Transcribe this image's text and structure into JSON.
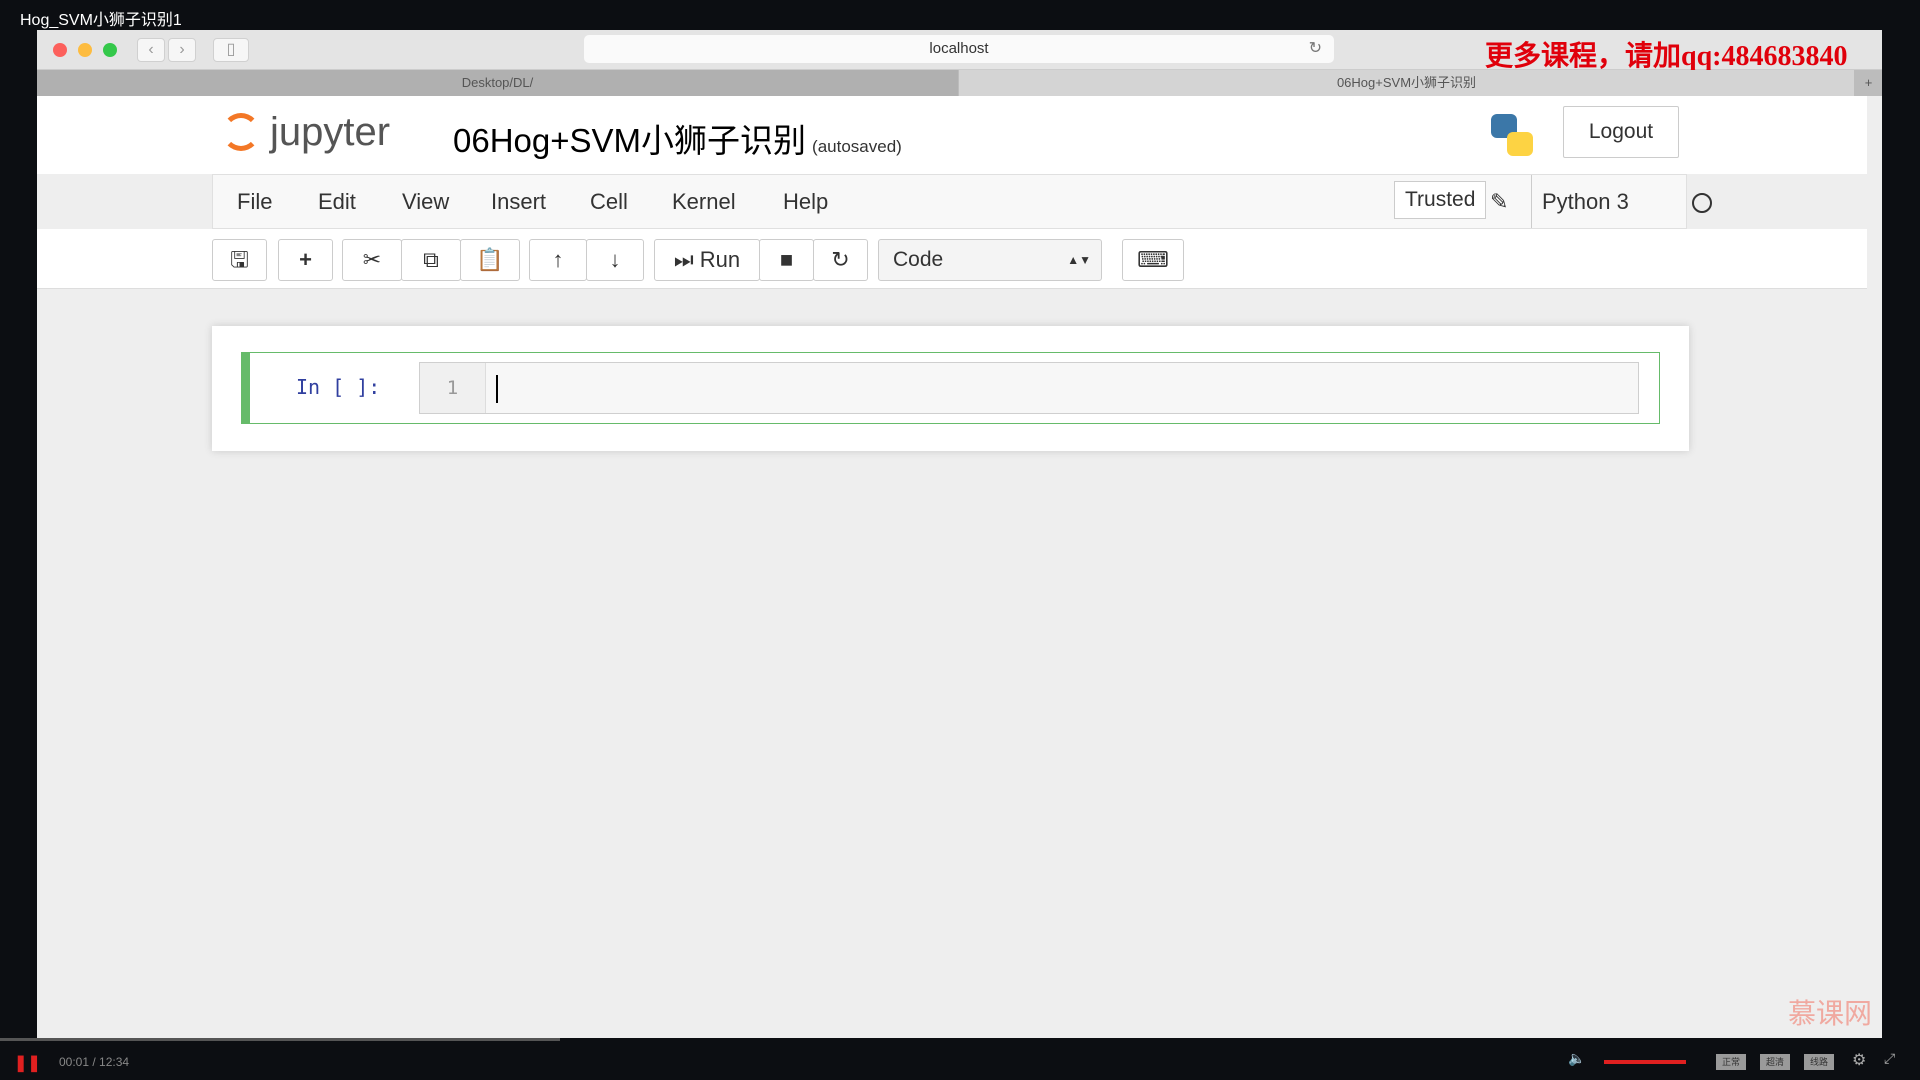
{
  "video": {
    "title": "Hog_SVM小狮子识别1",
    "time": "00:01 / 12:34",
    "quality": [
      "正常",
      "超清",
      "线路"
    ],
    "progress": 0.0013
  },
  "browser": {
    "url": "localhost",
    "promo": "更多课程，请加qq:484683840",
    "tabs": [
      "Desktop/DL/",
      "06Hog+SVM小狮子识别"
    ],
    "new_tab": "+"
  },
  "jupyter": {
    "logo": "jupyter",
    "notebook_title": "06Hog+SVM小狮子识别",
    "autosaved": "(autosaved)",
    "logout": "Logout",
    "menu": [
      "File",
      "Edit",
      "View",
      "Insert",
      "Cell",
      "Kernel",
      "Help"
    ],
    "trusted": "Trusted",
    "kernel": "Python 3",
    "toolbar": {
      "run": "Run",
      "cell_type": "Code"
    },
    "cell": {
      "prompt": "In [ ]:",
      "line_number": "1",
      "content": ""
    }
  },
  "watermark": "慕课网"
}
